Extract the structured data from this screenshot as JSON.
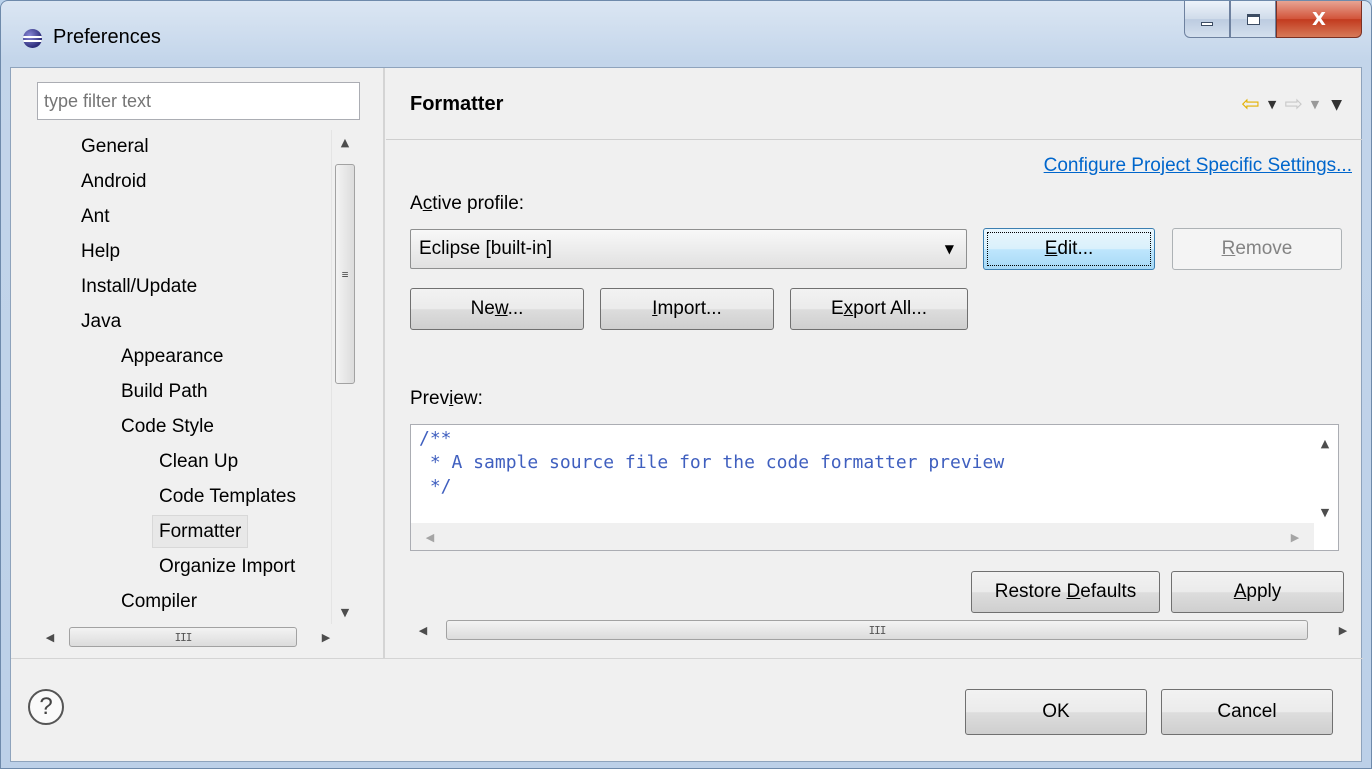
{
  "window": {
    "title": "Preferences",
    "minimize_glyph": "",
    "maximize_glyph": "",
    "close_glyph": "X"
  },
  "left": {
    "filter_placeholder": "type filter text",
    "tree": [
      {
        "label": "General",
        "level": 0
      },
      {
        "label": "Android",
        "level": 0
      },
      {
        "label": "Ant",
        "level": 0
      },
      {
        "label": "Help",
        "level": 0
      },
      {
        "label": "Install/Update",
        "level": 0
      },
      {
        "label": "Java",
        "level": 0
      },
      {
        "label": "Appearance",
        "level": 1
      },
      {
        "label": "Build Path",
        "level": 1
      },
      {
        "label": "Code Style",
        "level": 1
      },
      {
        "label": "Clean Up",
        "level": 2
      },
      {
        "label": "Code Templates",
        "level": 2
      },
      {
        "label": "Formatter",
        "level": 2,
        "selected": true
      },
      {
        "label": "Organize Import",
        "level": 2
      },
      {
        "label": "Compiler",
        "level": 1
      }
    ],
    "scroll_up": "▲",
    "scroll_down": "▼",
    "scroll_left": "◀",
    "scroll_right": "▶",
    "thumb_grip_v": "≡",
    "thumb_grip_h": "III"
  },
  "page": {
    "title": "Formatter",
    "back_icon": "⇦",
    "forward_icon": "⇨",
    "menu_icon": "▼",
    "link_label": "Configure Project Specific Settings...",
    "active_profile_label": "Active profile:",
    "profile_value": "Eclipse [built-in]",
    "combo_arrow": "▼",
    "edit_label": "Edit...",
    "remove_label": "Remove",
    "new_label": "New...",
    "import_label": "Import...",
    "export_label": "Export All...",
    "preview_label": "Preview:",
    "preview_code": [
      "/**",
      " * A sample source file for the code formatter preview",
      " */"
    ],
    "restore_label": "Restore Defaults",
    "apply_label": "Apply"
  },
  "footer": {
    "help_icon": "?",
    "ok_label": "OK",
    "cancel_label": "Cancel"
  }
}
